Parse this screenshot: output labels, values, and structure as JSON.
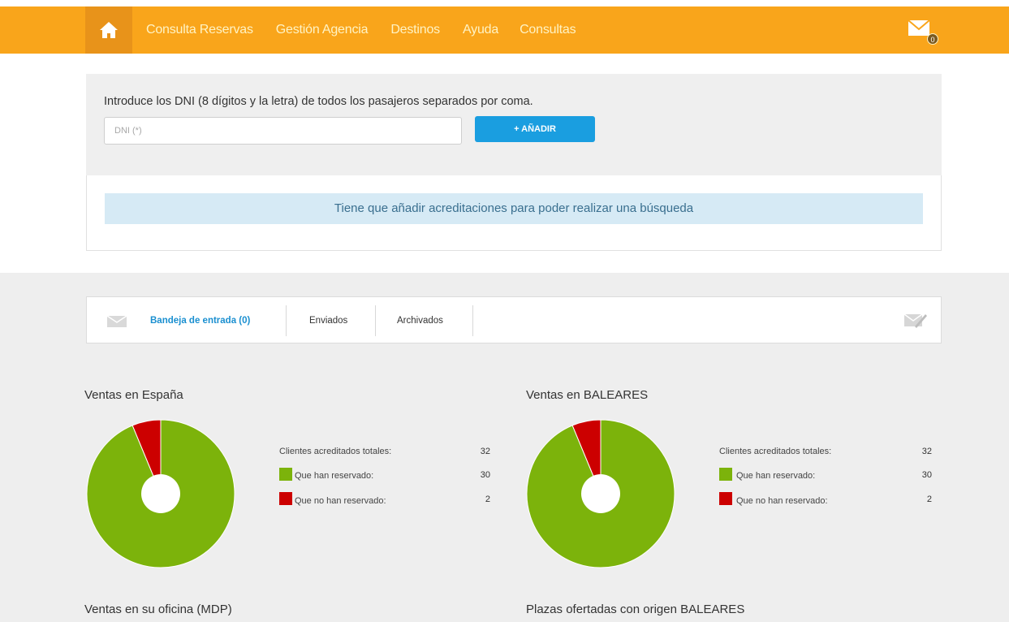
{
  "nav": {
    "links": [
      "Consulta Reservas",
      "Gestión Agencia",
      "Destinos",
      "Ayuda",
      "Consultas"
    ],
    "mail_count": "0",
    "color": "#f9a51b"
  },
  "search": {
    "instructions": "Introduce los DNI (8 dígitos y la letra) de todos los pasajeros separados por coma.",
    "placeholder": "DNI (*)",
    "add_label": "+ AÑADIR",
    "notice": "Tiene que añadir acreditaciones para poder realizar una búsqueda"
  },
  "tabs": {
    "inbox": "Bandeja de entrada (0)",
    "sent": "Enviados",
    "archived": "Archivados"
  },
  "chart_data": [
    {
      "type": "pie",
      "title": "Ventas en España",
      "total_label": "Clientes acreditados totales:",
      "total": 32,
      "categories": [
        "Que han reservado:",
        "Que no han reservado:"
      ],
      "values": [
        30,
        2
      ],
      "colors": [
        "#7cb30b",
        "#cc0000"
      ]
    },
    {
      "type": "pie",
      "title": "Ventas en BALEARES",
      "total_label": "Clientes acreditados totales:",
      "total": 32,
      "categories": [
        "Que han reservado:",
        "Que no han reservado:"
      ],
      "values": [
        30,
        2
      ],
      "colors": [
        "#7cb30b",
        "#cc0000"
      ]
    }
  ],
  "more_sections": [
    "Ventas en su oficina (MDP)",
    "Plazas ofertadas con origen BALEARES"
  ]
}
